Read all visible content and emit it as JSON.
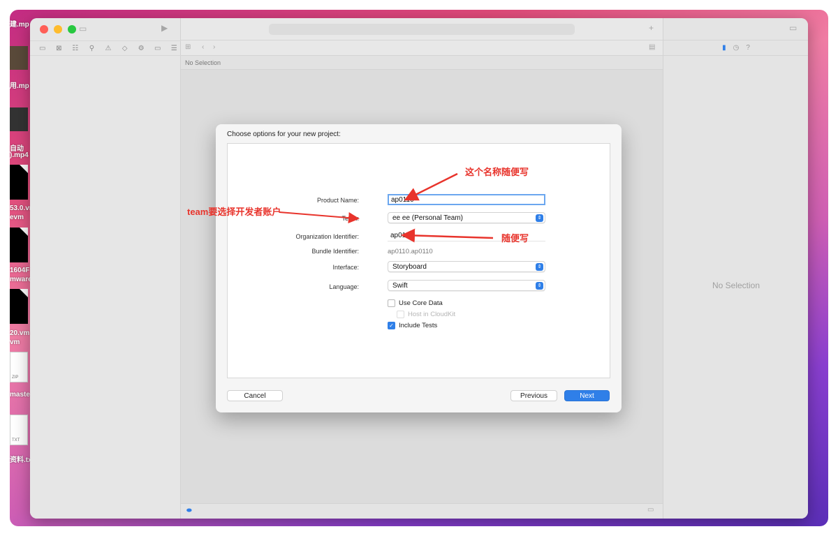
{
  "desktop": {
    "files": [
      {
        "name": "建.mp"
      },
      {
        "name": "用.mp"
      },
      {
        "name": "自动"
      },
      {
        "name": ").mp4"
      },
      {
        "name": "53.0.vr"
      },
      {
        "name": "evm"
      },
      {
        "name": "1604F"
      },
      {
        "name": "mware"
      },
      {
        "name": "20.vm"
      },
      {
        "name": "vm"
      },
      {
        "name": "maste"
      },
      {
        "name": "资料.tx"
      }
    ],
    "zip_label": "ZIP",
    "txt_label": "TXT"
  },
  "xcode": {
    "editor_no_selection": "No Selection",
    "inspector_no_selection": "No Selection",
    "icons": [
      "folder-icon",
      "source-control-icon",
      "symbol-icon",
      "find-icon",
      "issue-icon",
      "test-icon",
      "debug-icon",
      "breakpoint-icon",
      "report-icon",
      "run-icon",
      "add-icon",
      "related-items-icon",
      "back-icon",
      "forward-icon",
      "file-inspector-icon",
      "history-icon",
      "help-icon"
    ]
  },
  "dialog": {
    "title": "Choose options for your new project:",
    "product_name_label": "Product Name:",
    "product_name_value": "ap0110",
    "team_label": "Team:",
    "team_value": "ee ee (Personal Team)",
    "org_id_label": "Organization Identifier:",
    "org_id_value": "ap0110",
    "bundle_id_label": "Bundle Identifier:",
    "bundle_id_value": "ap0110.ap0110",
    "interface_label": "Interface:",
    "interface_value": "Storyboard",
    "language_label": "Language:",
    "language_value": "Swift",
    "use_core_data": {
      "label": "Use Core Data",
      "checked": false
    },
    "host_in_cloudkit": {
      "label": "Host in CloudKit",
      "checked": false,
      "disabled": true
    },
    "include_tests": {
      "label": "Include Tests",
      "checked": true
    },
    "cancel_label": "Cancel",
    "previous_label": "Previous",
    "next_label": "Next"
  },
  "annotations": {
    "product_name_note": "这个名称随便写",
    "team_note": "team要选择开发者账户",
    "org_note": "随便写",
    "color": "#e8342c"
  },
  "colors": {
    "accent": "#2f7fe8",
    "traffic_red": "#ff5f57",
    "traffic_yellow": "#febc2e",
    "traffic_green": "#28c840"
  }
}
